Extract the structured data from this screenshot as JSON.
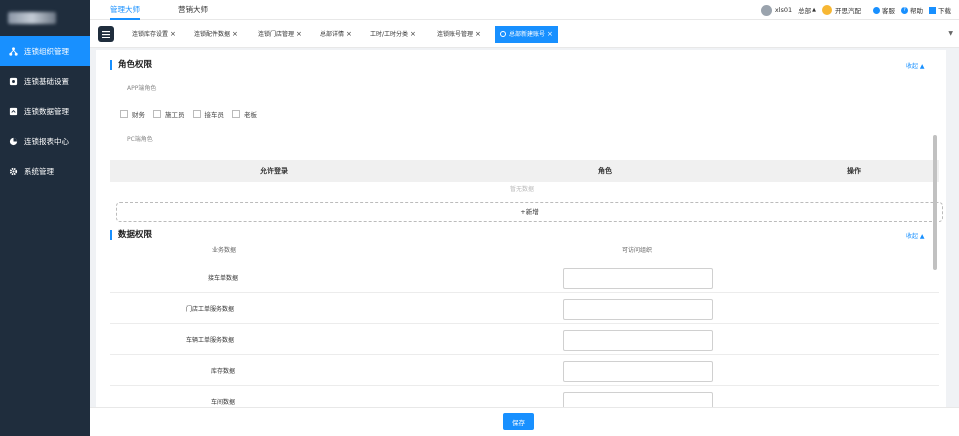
{
  "sidebar": {
    "items": [
      {
        "label": "连锁组织管理",
        "icon": "org-icon",
        "active": true
      },
      {
        "label": "连锁基础设置",
        "icon": "settings-box-icon",
        "active": false
      },
      {
        "label": "连锁数据管理",
        "icon": "data-icon",
        "active": false
      },
      {
        "label": "连锁报表中心",
        "icon": "report-icon",
        "active": false
      },
      {
        "label": "系统管理",
        "icon": "gear-icon",
        "active": false
      }
    ]
  },
  "topbar": {
    "tabs": [
      {
        "label": "管理大师",
        "active": true
      },
      {
        "label": "营销大师",
        "active": false
      }
    ],
    "user": "xls01",
    "branch": "总部",
    "store": "开思汽配",
    "service": "客服",
    "help": "帮助",
    "download": "下载"
  },
  "page_tabs": [
    {
      "label": "连锁库存设置"
    },
    {
      "label": "连锁配件数据"
    },
    {
      "label": "连锁门店管理"
    },
    {
      "label": "总部详情"
    },
    {
      "label": "工时/工时分类"
    },
    {
      "label": "连锁账号管理"
    },
    {
      "label": "总部新建账号",
      "active": true
    }
  ],
  "role_section": {
    "title": "角色权限",
    "collapse": "收起 ▲",
    "app_label": "APP端角色",
    "app_roles": [
      "财务",
      "施工员",
      "接车员",
      "老板"
    ],
    "pc_label": "PC端角色",
    "table_headers": [
      "允许登录",
      "角色",
      "操作"
    ],
    "empty_text": "暂无数据",
    "add_label": "+新增"
  },
  "data_section": {
    "title": "数据权限",
    "collapse": "收起 ▲",
    "headers": [
      "业务数据",
      "可访问组织"
    ],
    "rows": [
      {
        "label": "接车单数据",
        "value": ""
      },
      {
        "label": "门店工单服务数据",
        "value": ""
      },
      {
        "label": "车辆工单服务数据",
        "value": ""
      },
      {
        "label": "库存数据",
        "value": ""
      },
      {
        "label": "车间数据",
        "value": ""
      }
    ]
  },
  "footer": {
    "save_label": "保存"
  },
  "colors": {
    "accent": "#1890ff",
    "sidebar_bg": "#1f2d3d"
  }
}
